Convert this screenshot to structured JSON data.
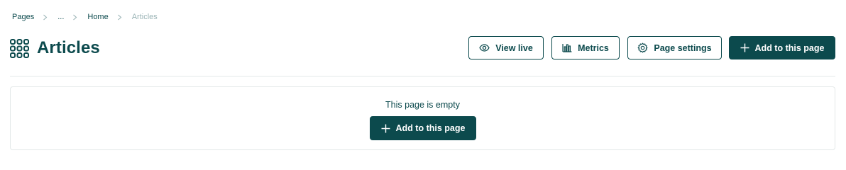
{
  "breadcrumb": {
    "items": [
      "Pages",
      "...",
      "Home",
      "Articles"
    ]
  },
  "header": {
    "title": "Articles",
    "icon": "grid-icon"
  },
  "actions": {
    "view_live": "View live",
    "metrics": "Metrics",
    "page_settings": "Page settings",
    "add_to_page": "Add to this page"
  },
  "empty_state": {
    "message": "This page is empty",
    "button_label": "Add to this page"
  },
  "colors": {
    "primary": "#0c4a4d",
    "muted": "#9bb4b6",
    "border": "#e3e8e8"
  }
}
